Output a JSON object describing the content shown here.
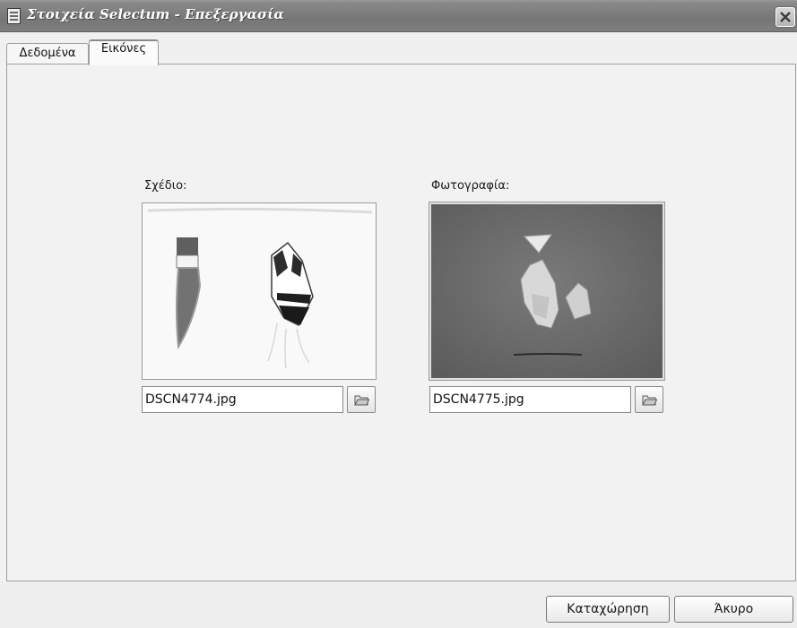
{
  "window": {
    "title": "Στοιχεία Selectum - Επεξεργασία"
  },
  "tabs": [
    {
      "label": "Δεδομένα",
      "selected": false
    },
    {
      "label": "Εικόνες",
      "selected": true
    }
  ],
  "drawing": {
    "label": "Σχέδιο:",
    "filename": "DSCN4774.jpg"
  },
  "photo": {
    "label": "Φωτογραφία:",
    "filename": "DSCN4775.jpg"
  },
  "buttons": {
    "save": "Καταχώρηση",
    "cancel": "Άκυρο"
  },
  "icons": {
    "window": "document-icon",
    "close": "close-icon",
    "browse": "folder-open-icon"
  }
}
